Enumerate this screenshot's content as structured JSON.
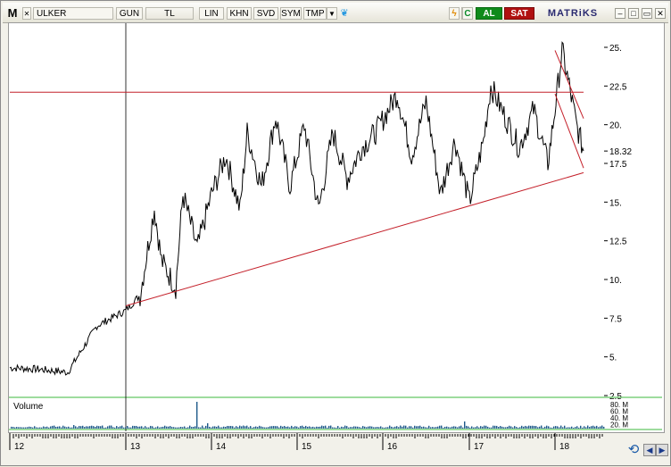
{
  "toolbar": {
    "logo": "M",
    "symbol": "ULKER",
    "period": "GUN",
    "currency": "TL",
    "scale": "LIN",
    "buttons": [
      "KHN",
      "SVD",
      "SYM",
      "TMP"
    ],
    "buy_label": "AL",
    "sell_label": "SAT",
    "brand": "MATRiKS",
    "lightning_icon": "lightning-icon",
    "c_icon": "c-icon"
  },
  "chart_data": {
    "type": "line",
    "title": "",
    "xlabel": "",
    "ylabel": "",
    "ylim": [
      2.5,
      26.5
    ],
    "y_ticks": [
      "25.",
      "22.5",
      "20.",
      "17.5",
      "15.",
      "12.5",
      "10.",
      "7.5",
      "5.",
      "2.5"
    ],
    "x_ticks": [
      "12",
      "13",
      "14",
      "15",
      "16",
      "17",
      "18"
    ],
    "last_price_label": "18.32",
    "series": [
      {
        "x": [
          "2012-01",
          "2012-04",
          "2012-07",
          "2012-10",
          "2013-01",
          "2013-03",
          "2013-05",
          "2013-06",
          "2013-08",
          "2013-09",
          "2013-11",
          "2014-01",
          "2014-03",
          "2014-05",
          "2014-06",
          "2014-08",
          "2014-10",
          "2014-12",
          "2015-02",
          "2015-04",
          "2015-06",
          "2015-08",
          "2015-10",
          "2015-12",
          "2016-03",
          "2016-05",
          "2016-07",
          "2016-09",
          "2016-11",
          "2017-01",
          "2017-03",
          "2017-04",
          "2017-06",
          "2017-08",
          "2017-10",
          "2017-12",
          "2018-01",
          "2018-02",
          "2018-03",
          "2018-04",
          "2018-05"
        ],
        "values": [
          4.3,
          4.2,
          4.0,
          7.0,
          8.0,
          9.0,
          14.6,
          11.2,
          9.5,
          15.5,
          12.0,
          15.5,
          18.0,
          14.5,
          19.5,
          16.0,
          20.5,
          16.0,
          20.0,
          14.5,
          19.5,
          16.5,
          18.5,
          19.5,
          22.0,
          18.0,
          21.5,
          15.5,
          19.0,
          15.0,
          19.0,
          22.5,
          20.5,
          18.5,
          21.0,
          17.5,
          21.0,
          24.8,
          22.5,
          20.0,
          18.3
        ]
      }
    ],
    "trendlines": [
      {
        "name": "horizontal-resistance",
        "points": [
          [
            "2012-01",
            22.1
          ],
          [
            "2018-05",
            22.1
          ]
        ]
      },
      {
        "name": "rising-support",
        "points": [
          [
            "2013-01",
            8.3
          ],
          [
            "2018-05",
            16.9
          ]
        ]
      },
      {
        "name": "channel-upper",
        "points": [
          [
            "2018-01",
            24.8
          ],
          [
            "2018-05",
            20.4
          ]
        ]
      },
      {
        "name": "channel-lower",
        "points": [
          [
            "2018-01",
            22.0
          ],
          [
            "2018-05",
            17.2
          ]
        ]
      }
    ],
    "cursor_x": "2013-01"
  },
  "volume": {
    "label": "Volume",
    "ticks": [
      "80. M",
      "60. M",
      "40. M",
      "20. M"
    ]
  },
  "colors": {
    "price": "#000000",
    "trendline": "#c4202a",
    "volume": "#1f5a8a",
    "grid_border": "#9a9a9a"
  }
}
